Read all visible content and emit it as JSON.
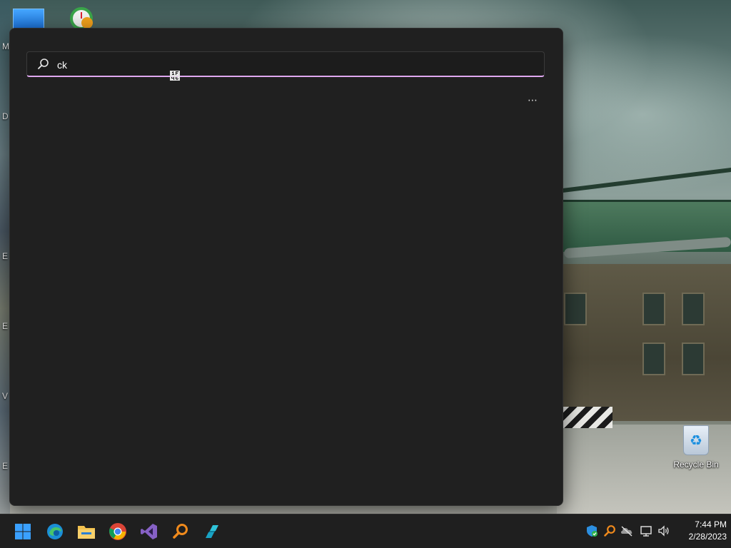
{
  "desktop": {
    "recycle_bin_label": "Recycle Bin",
    "edge_letters": [
      "M",
      "D",
      "E",
      "E",
      "V",
      "E"
    ]
  },
  "search": {
    "query": "ck",
    "more_label": "⋯",
    "accent_color": "#e0a8f0"
  },
  "taskbar": {
    "pinned": [
      {
        "name": "start-button",
        "icon": "windows-logo-icon"
      },
      {
        "name": "edge-button",
        "icon": "edge-icon"
      },
      {
        "name": "file-explorer-button",
        "icon": "folder-icon"
      },
      {
        "name": "chrome-button",
        "icon": "chrome-icon"
      },
      {
        "name": "visual-studio-button",
        "icon": "visual-studio-icon"
      },
      {
        "name": "search-tool-button",
        "icon": "magnifier-icon"
      },
      {
        "name": "app-button",
        "icon": "app-icon"
      }
    ],
    "tray": [
      "defender-icon",
      "magnifier-icon",
      "onedrive-icon",
      "network-icon",
      "volume-icon"
    ],
    "time": "7:44 PM",
    "date": "2/28/2023"
  }
}
